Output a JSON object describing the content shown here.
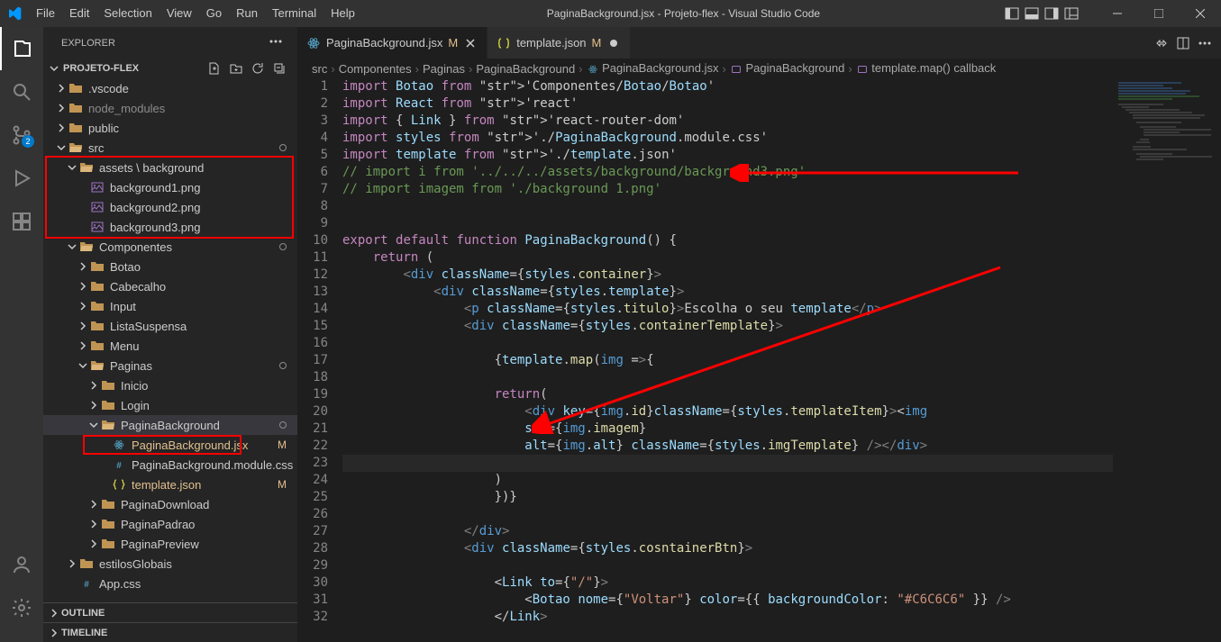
{
  "titlebar": {
    "title": "PaginaBackground.jsx - Projeto-flex - Visual Studio Code",
    "menu": [
      "File",
      "Edit",
      "Selection",
      "View",
      "Go",
      "Run",
      "Terminal",
      "Help"
    ]
  },
  "activitybar": {
    "scm_badge": "2"
  },
  "sidebar": {
    "title": "EXPLORER",
    "project": "PROJETO-FLEX",
    "tree": [
      {
        "kind": "folder",
        "label": ".vscode",
        "indent": 1,
        "open": false
      },
      {
        "kind": "folder",
        "label": "node_modules",
        "indent": 1,
        "open": false,
        "dimmed": true
      },
      {
        "kind": "folder",
        "label": "public",
        "indent": 1,
        "open": false
      },
      {
        "kind": "folder",
        "label": "src",
        "indent": 1,
        "open": true,
        "dot": true
      },
      {
        "kind": "folder",
        "label": "assets \\ background",
        "indent": 2,
        "open": true,
        "redbox": "assets-box"
      },
      {
        "kind": "file",
        "label": "background1.png",
        "indent": 3,
        "icon": "img"
      },
      {
        "kind": "file",
        "label": "background2.png",
        "indent": 3,
        "icon": "img"
      },
      {
        "kind": "file",
        "label": "background3.png",
        "indent": 3,
        "icon": "img"
      },
      {
        "kind": "folder",
        "label": "Componentes",
        "indent": 2,
        "open": true,
        "dot": true
      },
      {
        "kind": "folder",
        "label": "Botao",
        "indent": 3,
        "open": false
      },
      {
        "kind": "folder",
        "label": "Cabecalho",
        "indent": 3,
        "open": false
      },
      {
        "kind": "folder",
        "label": "Input",
        "indent": 3,
        "open": false
      },
      {
        "kind": "folder",
        "label": "ListaSuspensa",
        "indent": 3,
        "open": false
      },
      {
        "kind": "folder",
        "label": "Menu",
        "indent": 3,
        "open": false
      },
      {
        "kind": "folder",
        "label": "Paginas",
        "indent": 3,
        "open": true,
        "dot": true
      },
      {
        "kind": "folder",
        "label": "Inicio",
        "indent": 4,
        "open": false
      },
      {
        "kind": "folder",
        "label": "Login",
        "indent": 4,
        "open": false
      },
      {
        "kind": "folder",
        "label": "PaginaBackground",
        "indent": 4,
        "open": true,
        "active": true,
        "dot": true
      },
      {
        "kind": "file",
        "label": "PaginaBackground.jsx",
        "indent": 5,
        "icon": "react",
        "badge": "M",
        "mod": true,
        "redbox": "file-box"
      },
      {
        "kind": "file",
        "label": "PaginaBackground.module.css",
        "indent": 5,
        "icon": "css"
      },
      {
        "kind": "file",
        "label": "template.json",
        "indent": 5,
        "icon": "json",
        "badge": "M",
        "mod": true
      },
      {
        "kind": "folder",
        "label": "PaginaDownload",
        "indent": 4,
        "open": false
      },
      {
        "kind": "folder",
        "label": "PaginaPadrao",
        "indent": 4,
        "open": false
      },
      {
        "kind": "folder",
        "label": "PaginaPreview",
        "indent": 4,
        "open": false
      },
      {
        "kind": "folder",
        "label": "estilosGlobais",
        "indent": 2,
        "open": false
      },
      {
        "kind": "file",
        "label": "App.css",
        "indent": 2,
        "icon": "css"
      }
    ],
    "footer": [
      "OUTLINE",
      "TIMELINE"
    ]
  },
  "tabs": [
    {
      "label": "PaginaBackground.jsx",
      "icon": "react",
      "mod": "M",
      "active": true,
      "close": true
    },
    {
      "label": "template.json",
      "icon": "json",
      "mod": "M",
      "active": false,
      "dot": true
    }
  ],
  "breadcrumbs": [
    "src",
    "Componentes",
    "Paginas",
    "PaginaBackground",
    "PaginaBackground.jsx",
    "PaginaBackground",
    "template.map() callback"
  ],
  "code": {
    "start_line": 1,
    "lines": [
      "import Botao from 'Componentes/Botao/Botao'",
      "import React from 'react'",
      "import { Link } from 'react-router-dom'",
      "import styles from './PaginaBackground.module.css'",
      "import template from './template.json'",
      "// import i from '../../../assets/background/background3.png'",
      "// import imagem from './background 1.png'",
      "",
      "",
      "export default function PaginaBackground() {",
      "    return (",
      "        <div className={styles.container}>",
      "            <div className={styles.template}>",
      "                <p className={styles.titulo}>Escolha o seu template</p>",
      "                <div className={styles.containerTemplate}>",
      "",
      "                    {template.map(img =>{",
      "",
      "                    return(",
      "                        <div key={img.id}className={styles.templateItem}><img ",
      "                        src={img.imagem} ",
      "                        alt={img.alt} className={styles.imgTemplate} /></div>",
      "",
      "                    )",
      "                    })}",
      "",
      "                </div>",
      "                <div className={styles.cosntainerBtn}>",
      "",
      "                    <Link to={\"/\"}>",
      "                        <Botao nome={\"Voltar\"} color={{ backgroundColor: \"#C6C6C6\" }} />",
      "                    </Link>"
    ]
  }
}
